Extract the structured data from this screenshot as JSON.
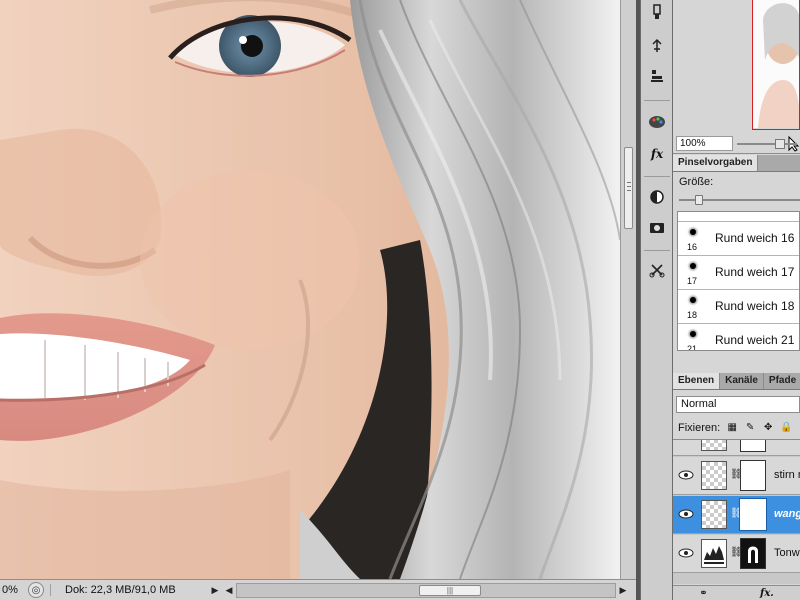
{
  "status": {
    "zoom": "0%",
    "doc": "Dok: 22,3 MB/91,0 MB"
  },
  "tools": [
    {
      "icon": "history-brush-icon"
    },
    {
      "icon": "puppet-pin-icon"
    },
    {
      "icon": "stamp-icon"
    },
    {
      "icon": "palette-icon"
    },
    {
      "icon": "fx-icon",
      "label": "fx"
    },
    {
      "icon": "contrast-icon"
    },
    {
      "icon": "camera-icon"
    },
    {
      "icon": "scissors-icon"
    }
  ],
  "navigator": {
    "zoom_value": "100%"
  },
  "brushes": {
    "tab": "Pinselvorgaben",
    "size_label": "Größe:",
    "size_fraction": 0.14,
    "items": [
      {
        "num": "16",
        "name": "Rund weich 16"
      },
      {
        "num": "17",
        "name": "Rund weich 17"
      },
      {
        "num": "18",
        "name": "Rund weich 18"
      },
      {
        "num": "21",
        "name": "Rund weich 21"
      }
    ]
  },
  "layers": {
    "tabs": [
      "Ebenen",
      "Kanäle",
      "Pfade"
    ],
    "blend_mode": "Normal",
    "lock_label": "Fixieren:",
    "rows": [
      {
        "name": "stirn n",
        "selected": false
      },
      {
        "name": "wang",
        "selected": true
      },
      {
        "name": "Tonw",
        "selected": false
      }
    ],
    "footer_icons": [
      "link-icon",
      "fx-icon"
    ],
    "footer_fx": "fx."
  },
  "colors": {
    "selection": "#3d8fe0",
    "navigator_frame": "#d42020"
  }
}
